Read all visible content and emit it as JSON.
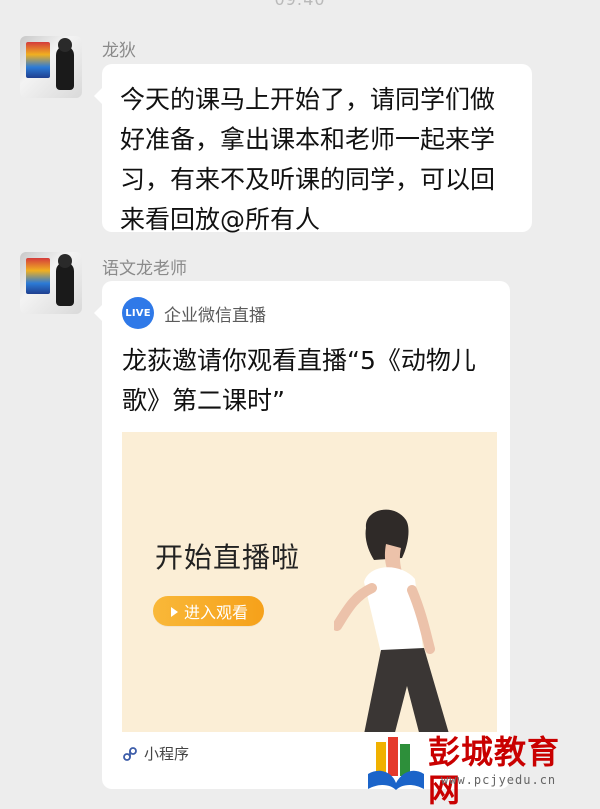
{
  "status_bar": {
    "time_partial": "09:40"
  },
  "messages": [
    {
      "sender_name": "龙狄",
      "text": "今天的课马上开始了，请同学们做好准备，拿出课本和老师一起来学习，有来不及听课的同学，可以回来看回放@所有人"
    },
    {
      "sender_name": "语文龙老师",
      "card": {
        "badge": "LIVE",
        "app_name": "企业微信直播",
        "title": "龙荻邀请你观看直播“5《动物儿歌》第二课时”",
        "preview_title": "开始直播啦",
        "button_label": "进入观看",
        "footer_label": "小程序"
      }
    }
  ],
  "watermark": {
    "name": "彭城教育网",
    "url": "www.pcjyedu.cn"
  },
  "colors": {
    "background": "#ededed",
    "bubble": "#ffffff",
    "live_badge": "#2f79e8",
    "preview_bg": "#fbeed6",
    "button": "#f6a11a",
    "watermark_red": "#c90000"
  },
  "icons": {
    "live": "live-badge-icon",
    "play": "play-icon",
    "mini_program": "mini-program-icon",
    "watermark_logo": "books-logo-icon"
  }
}
